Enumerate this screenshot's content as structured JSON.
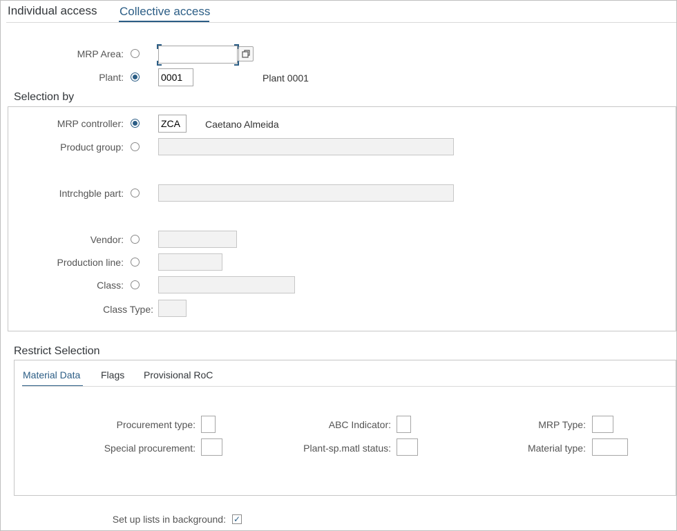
{
  "tabs": [
    {
      "label": "Individual access",
      "active": false
    },
    {
      "label": "Collective access",
      "active": true
    }
  ],
  "header_fields": {
    "mrp_area": {
      "label": "MRP Area:",
      "selected": false,
      "value": ""
    },
    "plant": {
      "label": "Plant:",
      "selected": true,
      "value": "0001",
      "description": "Plant 0001"
    }
  },
  "selection_by": {
    "title": "Selection by",
    "mrp_controller": {
      "label": "MRP controller:",
      "selected": true,
      "value": "ZCA",
      "description": "Caetano Almeida"
    },
    "product_group": {
      "label": "Product group:",
      "selected": false,
      "value": ""
    },
    "intrchgble_part": {
      "label": "Intrchgble part:",
      "selected": false,
      "value": ""
    },
    "vendor": {
      "label": "Vendor:",
      "selected": false,
      "value": ""
    },
    "production_line": {
      "label": "Production line:",
      "selected": false,
      "value": ""
    },
    "class": {
      "label": "Class:",
      "selected": false,
      "value": ""
    },
    "class_type": {
      "label": "Class Type:",
      "value": ""
    }
  },
  "restrict_selection": {
    "title": "Restrict Selection",
    "subtabs": [
      {
        "label": "Material Data",
        "active": true
      },
      {
        "label": "Flags",
        "active": false
      },
      {
        "label": "Provisional RoC",
        "active": false
      }
    ],
    "fields": {
      "procurement_type": {
        "label": "Procurement type:",
        "value": ""
      },
      "special_procurement": {
        "label": "Special procurement:",
        "value": ""
      },
      "abc_indicator": {
        "label": "ABC Indicator:",
        "value": ""
      },
      "plant_sp_matl_status": {
        "label": "Plant-sp.matl status:",
        "value": ""
      },
      "mrp_type": {
        "label": "MRP Type:",
        "value": ""
      },
      "material_type": {
        "label": "Material type:",
        "value": ""
      }
    }
  },
  "background": {
    "label": "Set up lists in background:",
    "checked": true,
    "check_glyph": "✓"
  },
  "icons": {
    "value_help": "value-help-icon"
  },
  "colors": {
    "accent": "#2b5d85",
    "border": "#c6c6c6",
    "disabled_bg": "#f2f2f2"
  }
}
